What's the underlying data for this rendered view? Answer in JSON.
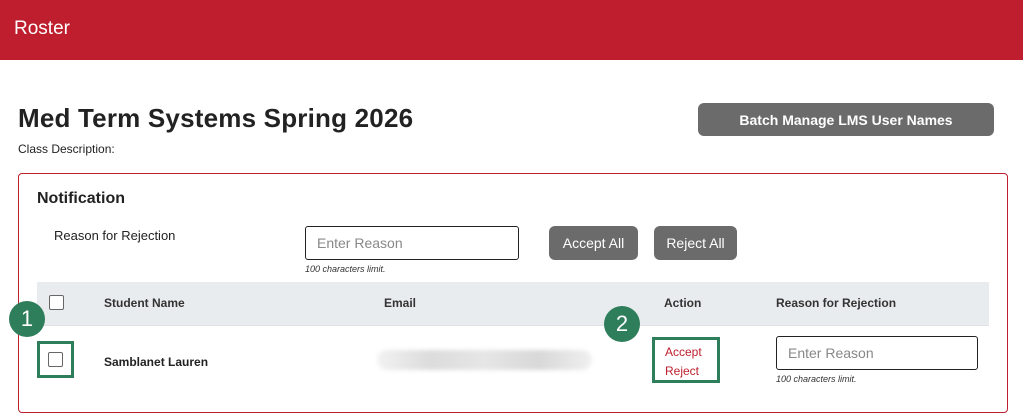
{
  "header": {
    "title": "Roster"
  },
  "class_info": {
    "title": "Med Term Systems Spring 2026",
    "description_label": "Class Description:"
  },
  "toolbar": {
    "batch_label": "Batch Manage LMS User Names"
  },
  "notification": {
    "title": "Notification",
    "reason_label": "Reason for Rejection",
    "reason_placeholder": "Enter Reason",
    "limit_text": "100 characters limit.",
    "accept_all_label": "Accept All",
    "reject_all_label": "Reject All"
  },
  "table": {
    "columns": [
      "Student Name",
      "Email",
      "Action",
      "Reason for Rejection"
    ],
    "rows": [
      {
        "student_name": "Samblanet Lauren",
        "accept_label": "Accept",
        "reject_label": "Reject",
        "reason_placeholder": "Enter Reason",
        "limit_text": "100 characters limit."
      }
    ]
  },
  "markers": [
    "1",
    "2"
  ],
  "colors": {
    "brand": "#be1e2d",
    "button": "#6b6b6b",
    "marker": "#2e7d5b"
  }
}
